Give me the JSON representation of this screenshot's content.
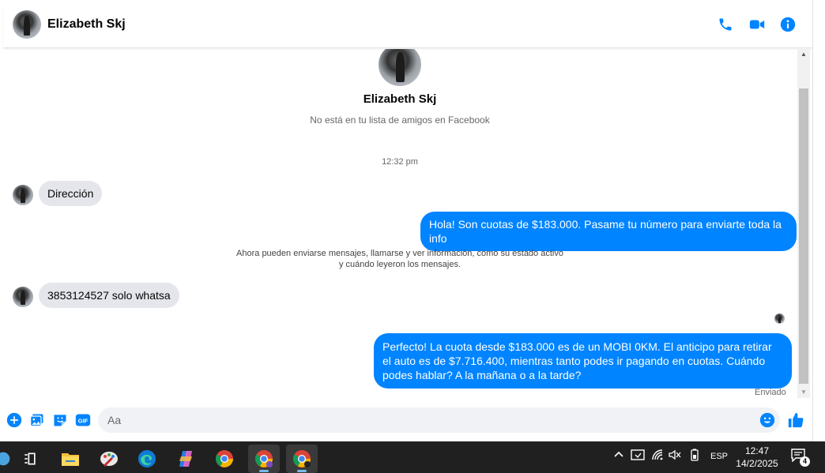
{
  "header": {
    "contact_name": "Elizabeth Skj"
  },
  "profile": {
    "name": "Elizabeth Skj",
    "subtitle": "No está en tu lista de amigos en Facebook"
  },
  "conversation": {
    "timestamp": "12:32 pm",
    "messages": [
      {
        "direction": "in",
        "text": "Dirección"
      },
      {
        "direction": "out",
        "text": "Hola! Son cuotas de $183.000. Pasame tu número para enviarte toda la info"
      },
      {
        "direction": "in",
        "text": "3853124527 solo whatsa"
      },
      {
        "direction": "out",
        "text": "Perfecto! La cuota desde $183.000 es de un MOBI 0KM. El anticipo para retirar el auto es de $7.716.400, mientras tanto podes ir pagando en cuotas. Cuándo podes hablar? A la mañana o a la tarde?"
      }
    ],
    "system_note_line1": "Ahora pueden enviarse mensajes, llamarse y ver información, como su estado activo",
    "system_note_line2": "y cuándo leyeron los mensajes.",
    "sent_status": "Enviado"
  },
  "composer": {
    "placeholder": "Aa",
    "gif_label": "GIF"
  },
  "taskbar": {
    "language": "ESP",
    "time": "12:47",
    "date": "14/2/2025",
    "notification_count": "4"
  },
  "colors": {
    "accent": "#0084ff",
    "incoming_bubble": "#e4e6eb",
    "taskbar": "#202020"
  }
}
